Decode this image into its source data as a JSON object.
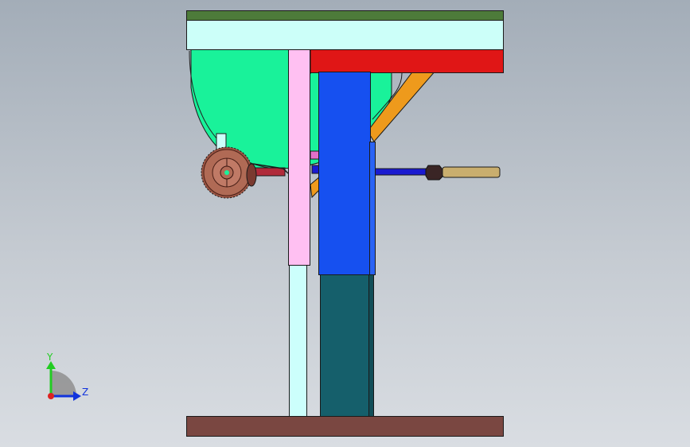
{
  "viewport": {
    "background_top": "#a3adb8",
    "background_bottom": "#d9dde2"
  },
  "parts": {
    "top_plate_color": "#4d7b3a",
    "upper_frame_color": "#ccfff9",
    "red_beam_color": "#e01616",
    "pink_column_color": "#ffc0f2",
    "cyan_leg_color": "#ccfffc",
    "blue_column_color": "#1650f0",
    "teal_base_column_color": "#155f6b",
    "base_plate_color": "#7a4741",
    "green_tank_color": "#19f29a",
    "orange_strut_color": "#ee9a1c",
    "saw_blade_color": "#b06a55",
    "shaft_color": "#1a1ad0",
    "brass_pin_color": "#c9ae6e",
    "nut_color": "#3a2525"
  },
  "triad": {
    "y_label": "Y",
    "z_label": "Z",
    "y_color": "#22cc22",
    "z_color": "#1133dd",
    "x_color": "#dd2222"
  }
}
